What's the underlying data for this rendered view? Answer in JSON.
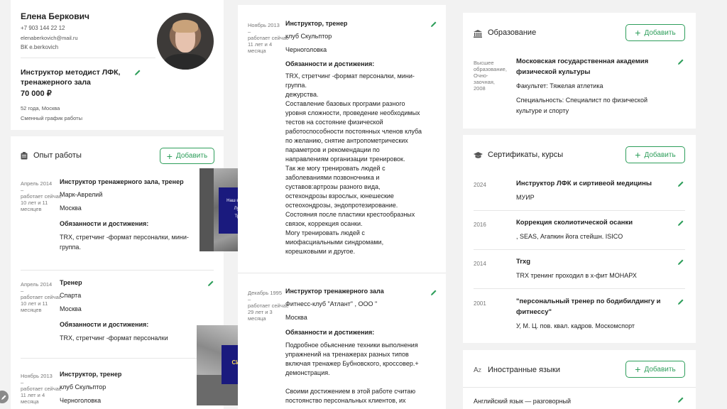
{
  "profile": {
    "name": "Елена Беркович",
    "phone": "+7 903 144 22 12",
    "email": "elenaberkovich@mail.ru",
    "vk": "ВК e.berkovich",
    "position_line1": "Инструктор методист ЛФК,",
    "position_line2": "тренажерного зала",
    "salary": "70 000 ₽",
    "age_city": "52 года, Москва",
    "schedule": "Сменный график работы"
  },
  "experience": {
    "title": "Опыт работы",
    "add_label": "Добавить",
    "items": [
      {
        "date": "Апрель 2014",
        "dash": "–",
        "now": "работает сейчас",
        "duration1": "10 лет и 11",
        "duration2": "месяцев",
        "position": "Инструктор тренажерного зала, тренер",
        "company": "Марк-Аврелий",
        "city": "Москва",
        "duties_title": "Обязанности и достижения:",
        "duties1": "TRX, стретчинг -формат персоналки, мини-",
        "duties2": "группа."
      },
      {
        "date": "Апрель 2014",
        "dash": "–",
        "now": "работает сейчас",
        "duration1": "10 лет и 11",
        "duration2": "месяцев",
        "position": "Тренер",
        "company": "Спарта",
        "city": "Москва",
        "duties_title": "Обязанности и достижения:",
        "duties1": "TRX, стретчинг -формат персоналки"
      },
      {
        "date": "Ноябрь 2013",
        "dash": "–",
        "now": "работает сейчас",
        "duration1": "11 лет и 4",
        "duration2": "месяца",
        "position": "Инструктор, тренер",
        "company": "клуб Скульптор",
        "city": "Черноголовка"
      }
    ]
  },
  "middle": {
    "job1": {
      "date": "Ноябрь 2013",
      "dash": "–",
      "now": "работает сейчас",
      "duration1": "11 лет и 4",
      "duration2": "месяца",
      "position": "Инструктор, тренер",
      "company": "клуб Скульптор",
      "city": "Черноголовка",
      "duties_title": "Обязанности и достижения:",
      "lines": [
        "TRX, стретчинг -формат персоналки, мини-",
        "группа.",
        "дежурства.",
        "Составление базовых програми разного",
        "уровня сложности, проведение необходимых",
        "тестов на состояние физической",
        "работоспособности постоянных членов клуба",
        "по желанию, снятие антропометрических",
        "параметров и рекомендации по",
        "направлениям организации тренировок.",
        "Так же могу тренировать людей с",
        "заболеваниями позвоночника и",
        "суставов:артрозы разного вида,",
        "остехондрозы взрослых, юнешеские",
        "остеохондрозы, эндопротезирование.",
        "Состояния после пластики крестообразных",
        "связок, коррекция осанки.",
        "Могу тренировать людей с",
        "миофасциальными синдромами,",
        "корешковыми и другое."
      ]
    },
    "job2": {
      "date": "Декабрь 1995",
      "dash": "–",
      "now": "работает сейчас",
      "duration1": "29 лет и 3",
      "duration2": "месяца",
      "position": "Инструктор тренажерного зала",
      "company": "Фитнесс-клуб \"Атлант\" , ООО \"",
      "city": "Москва",
      "duties_title": "Обязанности и достижения:",
      "lines": [
        "Подробное обьяснение техники выполнения",
        "упражнений на тренажерах разных типов",
        "включая тренажер Бубновского, кроссовер.+",
        "демонстрация."
      ],
      "lines2": [
        "Своими достижением в этой работе считаю",
        "постоянство персональных клиентов, их"
      ]
    }
  },
  "education": {
    "title": "Образование",
    "add_label": "Добавить",
    "level1": "Высшее",
    "level2": "образование,",
    "level3": "Очно-",
    "level4": "заочная,",
    "level5": "2008",
    "school1": "Московская государственная академия",
    "school2": "физической культуры",
    "faculty": "Факультет: Тяжелая атлетика",
    "spec1": "Специальность: Специалист по физической",
    "spec2": "культуре и спорту"
  },
  "certificates": {
    "title": "Сертификаты, курсы",
    "add_label": "Добавить",
    "items": [
      {
        "year": "2024",
        "name": "Инструктор ЛФК и сиртивеой медицины",
        "org": "МУИР"
      },
      {
        "year": "2016",
        "name": "Коррекция сколиотической осанки",
        "org": ", SEAS, Агапкин йога стейшн. ISICO"
      },
      {
        "year": "2014",
        "name": "Trxg",
        "org": "TRX тренинг проходил в х-фит МОНАРХ"
      },
      {
        "year": "2001",
        "name1": "\"персональный тренер по бодибилдингу и",
        "name2": "фитнессу\"",
        "org": "У, М. Ц. пов. квал. кадров. Москомспорт"
      }
    ]
  },
  "languages": {
    "title": "Иностранные языки",
    "add_label": "Добавить",
    "item": "Английский язык — разговорный"
  },
  "photos": {
    "overlay1_lines": [
      "Наш в команде",
      "Лучшие",
      "Тренер"
    ],
    "overlay2_lines": [
      "СИЛЫ"
    ]
  },
  "colors": {
    "accent": "#2e9e5b",
    "overlay_blue": "#1a1a7e"
  }
}
